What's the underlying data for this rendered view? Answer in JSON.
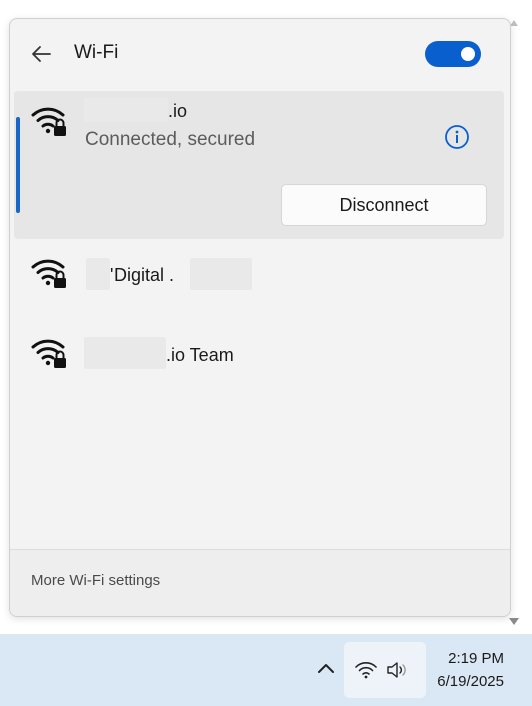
{
  "header": {
    "title": "Wi-Fi",
    "toggle_state": "on"
  },
  "networks": [
    {
      "name_suffix": ".io",
      "status": "Connected, secured",
      "connected": true,
      "secured": true,
      "action_label": "Disconnect"
    },
    {
      "name_prefix": "'",
      "name_text": "Digital .",
      "secured": true
    },
    {
      "name_suffix": ".io Team",
      "secured": true
    }
  ],
  "footer": {
    "link_label": "More Wi-Fi settings"
  },
  "taskbar": {
    "time": "2:19 PM",
    "date": "6/19/2025"
  },
  "colors": {
    "accent": "#0a5fcf",
    "panel_bg": "#f3f3f3",
    "selected_row_bg": "#e6e6e6",
    "taskbar_bg": "#dae7f4"
  },
  "icons": {
    "back": "arrow-left-icon",
    "wifi_secured": "wifi-lock-icon",
    "info": "info-icon",
    "tray_chevron": "chevron-up-icon",
    "tray_wifi": "wifi-icon",
    "tray_volume": "speaker-icon"
  }
}
